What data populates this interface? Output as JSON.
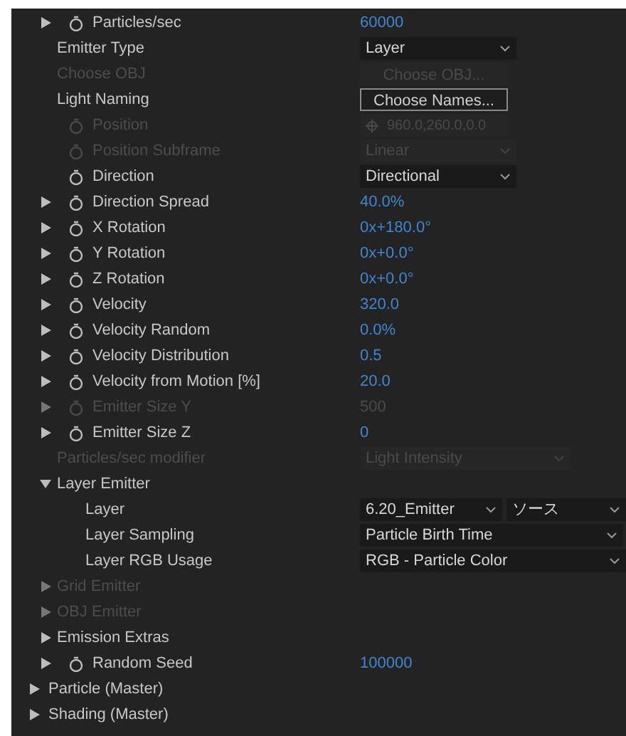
{
  "properties": [
    {
      "label": "Particles/sec",
      "twirl": true,
      "expanded": false,
      "stopwatch": true,
      "disabled": false,
      "value": {
        "kind": "number",
        "text": "60000"
      }
    },
    {
      "label": "Emitter Type",
      "twirl": false,
      "stopwatch": false,
      "disabled": false,
      "value": {
        "kind": "dropdown",
        "text": "Layer"
      }
    },
    {
      "label": "Choose OBJ",
      "twirl": false,
      "stopwatch": false,
      "disabled": true,
      "value": {
        "kind": "button",
        "text": "Choose OBJ..."
      }
    },
    {
      "label": "Light Naming",
      "twirl": false,
      "stopwatch": false,
      "disabled": false,
      "value": {
        "kind": "button",
        "text": "Choose Names..."
      }
    },
    {
      "label": "Position",
      "twirl": false,
      "stopwatch": true,
      "disabled": true,
      "value": {
        "kind": "point",
        "text": "960.0,260.0,0.0"
      }
    },
    {
      "label": "Position Subframe",
      "twirl": false,
      "stopwatch": true,
      "disabled": true,
      "value": {
        "kind": "dropdown",
        "text": "Linear"
      }
    },
    {
      "label": "Direction",
      "twirl": false,
      "stopwatch": true,
      "disabled": false,
      "value": {
        "kind": "dropdown",
        "text": "Directional"
      }
    },
    {
      "label": "Direction Spread",
      "twirl": true,
      "expanded": false,
      "stopwatch": true,
      "disabled": false,
      "value": {
        "kind": "number",
        "text": "40.0%"
      }
    },
    {
      "label": "X Rotation",
      "twirl": true,
      "expanded": false,
      "stopwatch": true,
      "disabled": false,
      "value": {
        "kind": "number",
        "text": "0x+180.0°"
      }
    },
    {
      "label": "Y Rotation",
      "twirl": true,
      "expanded": false,
      "stopwatch": true,
      "disabled": false,
      "value": {
        "kind": "number",
        "text": "0x+0.0°"
      }
    },
    {
      "label": "Z Rotation",
      "twirl": true,
      "expanded": false,
      "stopwatch": true,
      "disabled": false,
      "value": {
        "kind": "number",
        "text": "0x+0.0°"
      }
    },
    {
      "label": "Velocity",
      "twirl": true,
      "expanded": false,
      "stopwatch": true,
      "disabled": false,
      "value": {
        "kind": "number",
        "text": "320.0"
      }
    },
    {
      "label": "Velocity Random",
      "twirl": true,
      "expanded": false,
      "stopwatch": true,
      "disabled": false,
      "value": {
        "kind": "number",
        "text": "0.0%"
      }
    },
    {
      "label": "Velocity Distribution",
      "twirl": true,
      "expanded": false,
      "stopwatch": true,
      "disabled": false,
      "value": {
        "kind": "number",
        "text": "0.5"
      }
    },
    {
      "label": "Velocity from Motion [%]",
      "twirl": true,
      "expanded": false,
      "stopwatch": true,
      "disabled": false,
      "value": {
        "kind": "number",
        "text": "20.0"
      }
    },
    {
      "label": "Emitter Size Y",
      "twirl": true,
      "expanded": false,
      "stopwatch": true,
      "disabled": true,
      "value": {
        "kind": "number",
        "text": "500"
      }
    },
    {
      "label": "Emitter Size Z",
      "twirl": true,
      "expanded": false,
      "stopwatch": true,
      "disabled": false,
      "value": {
        "kind": "number",
        "text": "0"
      }
    },
    {
      "label": "Particles/sec modifier",
      "twirl": false,
      "stopwatch": false,
      "disabled": true,
      "value": {
        "kind": "wide_dropdown",
        "text": "Light Intensity"
      }
    },
    {
      "label": "Layer Emitter",
      "twirl": true,
      "expanded": true,
      "stopwatch": false,
      "disabled": false,
      "children": [
        {
          "label": "Layer",
          "twirl": false,
          "stopwatch": false,
          "disabled": false,
          "value": {
            "kind": "dropdown_pair",
            "options": [
              "6.20_Emitter",
              "ソース"
            ]
          }
        },
        {
          "label": "Layer Sampling",
          "twirl": false,
          "stopwatch": false,
          "disabled": false,
          "value": {
            "kind": "long_dropdown",
            "text": "Particle Birth Time"
          }
        },
        {
          "label": "Layer RGB Usage",
          "twirl": false,
          "stopwatch": false,
          "disabled": false,
          "value": {
            "kind": "full_dropdown",
            "text": "RGB - Particle Color"
          }
        }
      ]
    },
    {
      "label": "Grid Emitter",
      "twirl": true,
      "expanded": false,
      "stopwatch": false,
      "disabled": true
    },
    {
      "label": "OBJ Emitter",
      "twirl": true,
      "expanded": false,
      "stopwatch": false,
      "disabled": true
    },
    {
      "label": "Emission Extras",
      "twirl": true,
      "expanded": false,
      "stopwatch": false,
      "disabled": false
    },
    {
      "label": "Random Seed",
      "twirl": true,
      "expanded": false,
      "stopwatch": true,
      "disabled": false,
      "value": {
        "kind": "number",
        "text": "100000"
      }
    }
  ],
  "master_groups": [
    {
      "label": "Particle (Master)",
      "expanded": false
    },
    {
      "label": "Shading (Master)",
      "expanded": false
    }
  ]
}
